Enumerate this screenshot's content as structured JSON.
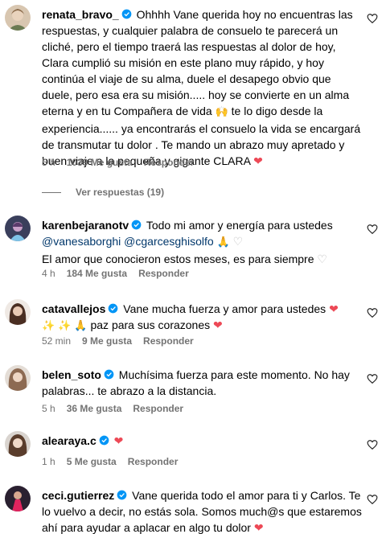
{
  "comments": [
    {
      "username": "renata_bravo_",
      "text": "Ohhhh Vane querida hoy no encuentras las respuestas, y cualquier palabra de consuelo te parecerá un cliché, pero el tiempo traerá las respuestas al dolor de hoy, Clara cumplió su misión en este plano muy rápido, y hoy continúa el viaje de su alma, duele el desapego obvio que duele, pero esa era su misión..... hoy se convierte en un alma eterna y en tu Compañera de vida",
      "text_2": "te lo digo desde la experiencia...... ya encontrarás el consuelo la vida se encargará de transmutar tu dolor . Te mando un abrazo muy apretado y buen viaje a la pequeña y gigante CLARA",
      "time": "5 h",
      "likes": "1039 Me gusta",
      "reply": "Responder",
      "view_replies": "Ver respuestas (19)"
    },
    {
      "username": "karenbejaranotv",
      "text": "Todo mi amor y energía para ustedes",
      "mentions": "@vanesaborghi @cgarcesghisolfo",
      "text_2": "El amor que conocieron estos meses, es para siempre",
      "time": "4 h",
      "likes": "184 Me gusta",
      "reply": "Responder"
    },
    {
      "username": "catavallejos",
      "text": "Vane mucha fuerza y amor para ustedes",
      "text_2": "paz para sus corazones",
      "time": "52 min",
      "likes": "9 Me gusta",
      "reply": "Responder"
    },
    {
      "username": "belen_soto",
      "text": "Muchísima fuerza para este momento. No hay palabras... te abrazo a la distancia.",
      "time": "5 h",
      "likes": "36 Me gusta",
      "reply": "Responder"
    },
    {
      "username": "alearaya.c",
      "text": "",
      "time": "1 h",
      "likes": "5 Me gusta",
      "reply": "Responder"
    },
    {
      "username": "ceci.gutierrez",
      "text": "Vane querida todo el amor para ti y Carlos. Te lo vuelvo a decir, no estás sola. Somos much@s que estaremos ahí para ayudar a aplacar en algo tu dolor"
    }
  ],
  "colors": {
    "verified": "#0095f6",
    "heart": "#ed4956",
    "meta": "#737373",
    "mention": "#00376b"
  },
  "icons": [
    "verified-badge-icon",
    "heart-outline-icon",
    "heart-red-icon",
    "praying-hands-emoji",
    "sparkles-emoji"
  ]
}
